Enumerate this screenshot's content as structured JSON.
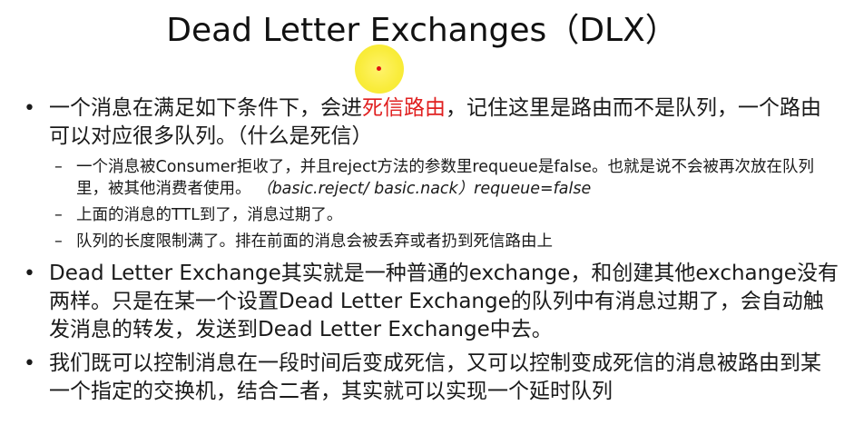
{
  "slide": {
    "title": "Dead Letter Exchanges（DLX）",
    "bullets": [
      {
        "pre": "一个消息在满足如下条件下，会进",
        "highlight": "死信路由",
        "post": "，记住这里是路由而不是队列，一个路由可以对应很多队列。（什么是死信）",
        "subs": [
          {
            "text": "一个消息被Consumer拒收了，并且reject方法的参数里requeue是false。也就是说不会被再次放在队列里，被其他消费者使用。",
            "italic": "（basic.reject/ basic.nack）requeue=false"
          },
          {
            "text": "上面的消息的TTL到了，消息过期了。"
          },
          {
            "text": "队列的长度限制满了。排在前面的消息会被丢弃或者扔到死信路由上"
          }
        ]
      },
      {
        "text": "Dead Letter Exchange其实就是一种普通的exchange，和创建其他exchange没有两样。只是在某一个设置Dead Letter Exchange的队列中有消息过期了，会自动触发消息的转发，发送到Dead Letter Exchange中去。"
      },
      {
        "text": "我们既可以控制消息在一段时间后变成死信，又可以控制变成死信的消息被路由到某一个指定的交换机，结合二者，其实就可以实现一个延时队列"
      }
    ],
    "bullet_symbol": "•",
    "dash_symbol": "–",
    "colors": {
      "highlight": "#e02020",
      "cursor": "#f6e82d",
      "cursor_dot": "#e01010"
    }
  }
}
